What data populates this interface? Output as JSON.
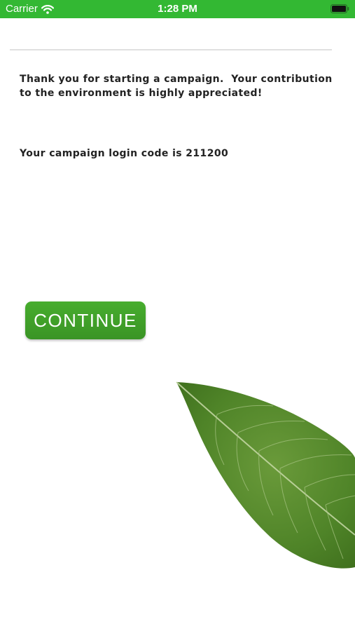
{
  "status_bar": {
    "carrier": "Carrier",
    "time": "1:28 PM",
    "icons": [
      "wifi-icon",
      "battery-icon"
    ],
    "background_color": "#33b833"
  },
  "main": {
    "message": "Thank you for starting a campaign.  Your contribution to the environment is highly appreciated!",
    "code_line": "Your campaign login code is 211200"
  },
  "continue_button": {
    "label": "CONTINUE",
    "color": "#40a12a"
  },
  "decoration": {
    "icon": "leaf-image"
  }
}
